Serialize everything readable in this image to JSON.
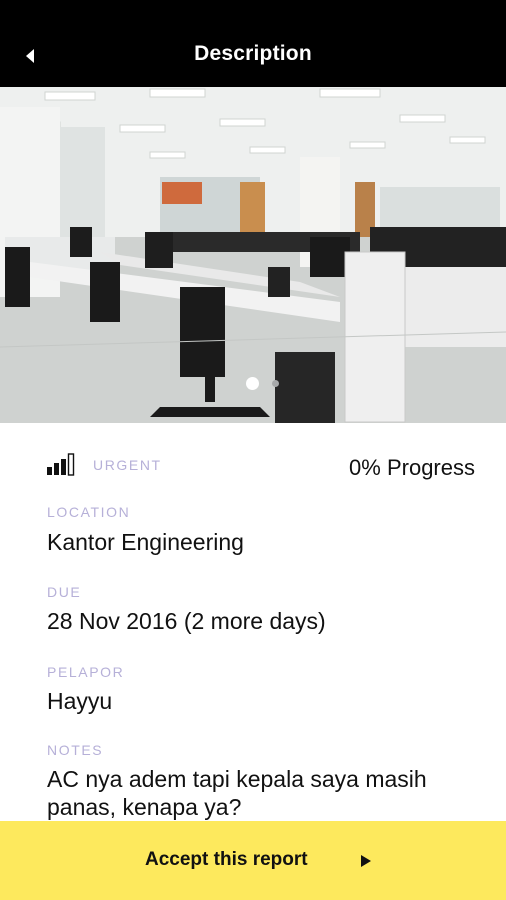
{
  "header": {
    "title": "Description",
    "back_icon": "back-arrow-icon"
  },
  "carousel": {
    "image_description_icon": "office-photo",
    "page_count": 2,
    "active_index": 0
  },
  "report": {
    "priority_icon": "signal-bars-icon",
    "priority": "URGENT",
    "progress": "0% Progress",
    "location_label": "LOCATION",
    "location": "Kantor Engineering",
    "due_label": "DUE",
    "due": "28 Nov 2016 (2 more days)",
    "reporter_label": "PELAPOR",
    "reporter": "Hayyu",
    "notes_label": "NOTES",
    "notes": "AC nya adem tapi kepala saya masih panas, kenapa ya?"
  },
  "footer": {
    "accept_label": "Accept this report",
    "arrow_icon": "play-arrow-icon"
  },
  "colors": {
    "header_bg": "#000000",
    "label_color": "#b6b0d8",
    "footer_bg": "#fde95d"
  }
}
